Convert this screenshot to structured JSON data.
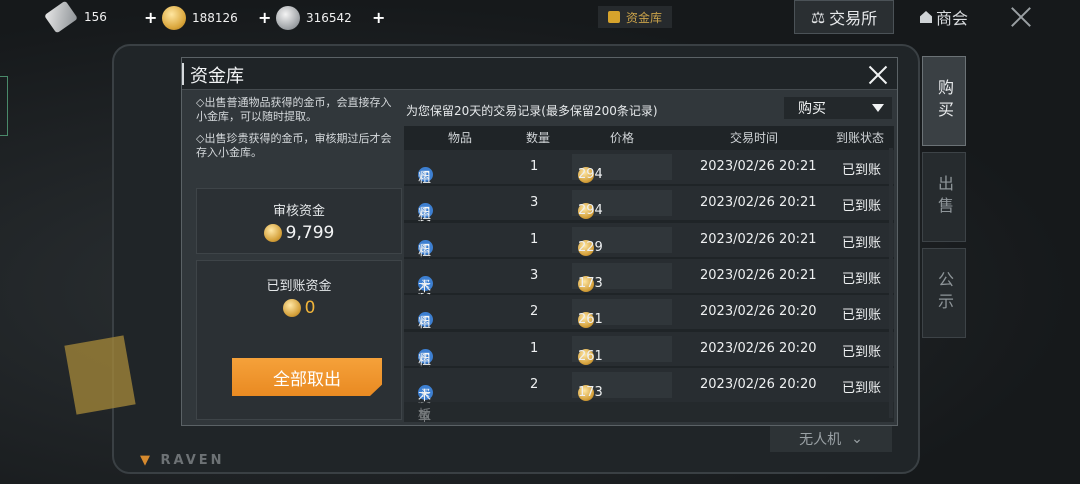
{
  "topbar": {
    "tickets": "156",
    "gold": "188126",
    "silver": "316542",
    "vault_tab": "资金库",
    "exchange": "交易所",
    "shop": "商会"
  },
  "side_tabs": [
    "购买",
    "出售",
    "公示"
  ],
  "background": {
    "brand": "RAVEN",
    "drone": "无人机"
  },
  "modal": {
    "title": "资金库",
    "notes": [
      "◇出售普通物品获得的金币，会直接存入小金库，可以随时提取。",
      "◇出售珍贵获得的金币，审核期过后才会存入小金库。"
    ],
    "review_label": "审核资金",
    "review_value": "9,799",
    "arrived_label": "已到账资金",
    "arrived_value": "0",
    "withdraw_label": "全部取出",
    "records_title": "为您保留20天的交易记录(最多保留200条记录)",
    "filter_value": "购买",
    "columns": [
      "物品",
      "数量",
      "价格",
      "交易时间",
      "到账状态"
    ],
    "rows": [
      {
        "badge": "买",
        "item": "粗制皮革",
        "qty": "1",
        "price": "294",
        "time": "2023/02/26  20:21",
        "status": "已到账"
      },
      {
        "badge": "买",
        "item": "粗制皮革",
        "qty": "3",
        "price": "294",
        "time": "2023/02/26  20:21",
        "status": "已到账"
      },
      {
        "badge": "买",
        "item": "粗制皮革",
        "qty": "1",
        "price": "229",
        "time": "2023/02/26  20:21",
        "status": "已到账"
      },
      {
        "badge": "买",
        "item": "木板",
        "qty": "3",
        "price": "173",
        "time": "2023/02/26  20:21",
        "status": "已到账"
      },
      {
        "badge": "买",
        "item": "粗制皮革",
        "qty": "2",
        "price": "261",
        "time": "2023/02/26  20:20",
        "status": "已到账"
      },
      {
        "badge": "买",
        "item": "粗制皮革",
        "qty": "1",
        "price": "261",
        "time": "2023/02/26  20:20",
        "status": "已到账"
      },
      {
        "badge": "买",
        "item": "木板",
        "qty": "2",
        "price": "173",
        "time": "2023/02/26  20:20",
        "status": "已到账"
      }
    ]
  }
}
